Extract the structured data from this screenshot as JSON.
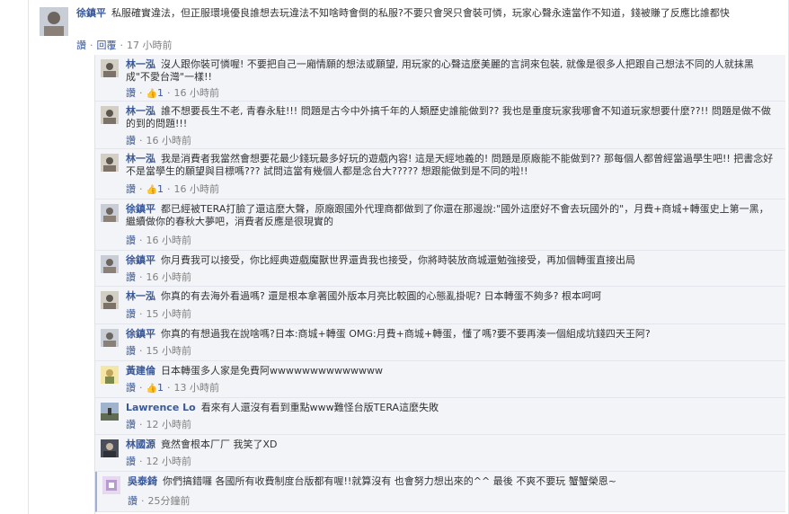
{
  "top_comment": {
    "author": "徐鎮平",
    "text": "私服確實違法，但正服環境優良誰想去玩違法不知啥時會倒的私服?不要只會哭只會裝可憐，玩家心聲永遠當作不知道，錢被賺了反應比誰都快",
    "like_label": "讚",
    "reply_label": "回覆",
    "time": "17 小時前"
  },
  "replies": [
    {
      "author": "林一泓",
      "text": "沒人跟你裝可憐喔! 不要把自己一廂情願的想法或願望, 用玩家的心聲這麼美麗的言詞來包裝, 就像是很多人把跟自己想法不同的人就抹黑成\"不愛台灣\"一樣!!",
      "like_label": "讚",
      "likes": "1",
      "time": "16 小時前"
    },
    {
      "author": "林一泓",
      "text": "誰不想要長生不老, 青春永駐!!! 問題是古今中外搞千年的人類歷史誰能做到?? 我也是重度玩家我哪會不知道玩家想要什麼??!! 問題是做不做的到的問題!!!",
      "like_label": "讚",
      "likes": "",
      "time": "16 小時前"
    },
    {
      "author": "林一泓",
      "text": "我是消費者我當然會想要花最少錢玩最多好玩的遊戲內容! 這是天經地義的! 問題是原廠能不能做到?? 那每個人都曾經當過學生吧!! 把書念好不是當學生的願望與目標嗎??? 試問這當有幾個人都是念台大????? 想跟能做到是不同的啦!!",
      "like_label": "讚",
      "likes": "1",
      "time": "16 小時前"
    },
    {
      "author": "徐鎮平",
      "text": "都已經被TERA打臉了還這麼大聲，原廠跟國外代理商都做到了你還在那邊說:\"國外這麼好不會去玩國外的\"，月費+商城+轉蛋史上第一黑，繼續做你的春秋大夢吧，消費者反應是很現實的",
      "like_label": "讚",
      "likes": "",
      "time": "16 小時前"
    },
    {
      "author": "徐鎮平",
      "text": "你月費我可以接受，你比經典遊戲魔獸世界還貴我也接受，你將時裝放商城還勉強接受，再加個轉蛋直接出局",
      "like_label": "讚",
      "likes": "",
      "time": "16 小時前"
    },
    {
      "author": "林一泓",
      "text": "你真的有去海外看過嗎? 還是根本拿著國外版本月亮比較圓的心態亂掛呢? 日本轉蛋不夠多? 根本呵呵",
      "like_label": "讚",
      "likes": "",
      "time": "15 小時前"
    },
    {
      "author": "徐鎮平",
      "text": "你真的有想過我在說啥嗎?日本:商城+轉蛋 OMG:月費+商城+轉蛋，懂了嗎?要不要再湊一個組成坑錢四天王阿?",
      "like_label": "讚",
      "likes": "",
      "time": "15 小時前"
    },
    {
      "author": "黃建倫",
      "text": "日本轉蛋多人家是免費阿wwwwwwwwwwwwww",
      "like_label": "讚",
      "likes": "1",
      "time": "13 小時前"
    },
    {
      "author": "Lawrence Lo",
      "text": "看來有人還沒有看到重點www難怪台版TERA這麼失敗",
      "like_label": "讚",
      "likes": "",
      "time": "12 小時前"
    },
    {
      "author": "林國源",
      "text": "竟然會根本厂厂 我笑了XD",
      "like_label": "讚",
      "likes": "",
      "time": "12 小時前"
    },
    {
      "author": "吳泰錡",
      "text": "你們搞錯囉 各國所有收費制度台版都有喔!!就算沒有 也會努力想出來的^^ 最後 不爽不要玩 蟹蟹榮恩~",
      "like_label": "讚",
      "likes": "",
      "time": "25分鐘前"
    }
  ],
  "colors": {
    "link": "#3b5998",
    "reply_bg": "#f2f4f8",
    "meta": "#808080"
  }
}
